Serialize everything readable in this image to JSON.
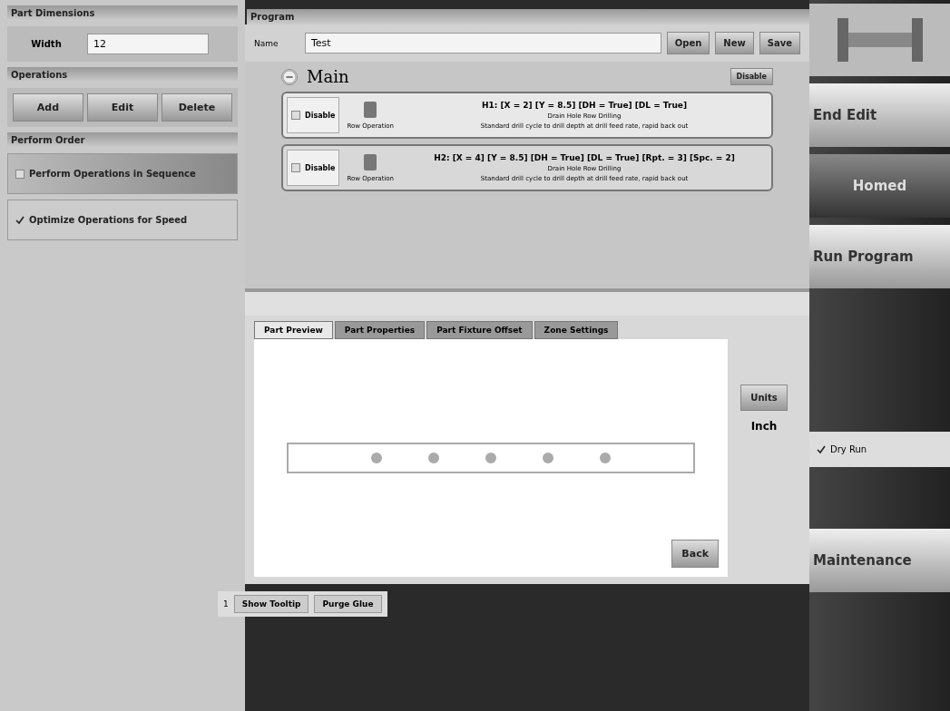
{
  "part_dimensions": {
    "title": "Part Dimensions",
    "label": "Width",
    "value": "12"
  },
  "operations": {
    "title": "Operations",
    "buttons": [
      "Add",
      "Edit",
      "Delete"
    ]
  },
  "perform_order": {
    "title": "Perform Order",
    "options": [
      {
        "label": "Perform Operations in Sequence",
        "selected": true,
        "checked": false
      },
      {
        "label": "Optimize Operations for Speed",
        "selected": false,
        "checked": true
      }
    ]
  },
  "program": {
    "title": "Program",
    "name_label": "Name",
    "name_value": "Test",
    "buttons": [
      "Open",
      "New",
      "Save"
    ],
    "group": {
      "title": "Main",
      "expanded": true,
      "disable_label": "Disable",
      "operations": [
        {
          "disable_label": "Disable",
          "checked": false,
          "type_label": "Row Operation",
          "title": "H1: [X = 2] [Y = 8.5] [DH = True] [DL = True]",
          "subtitle": "Drain Hole Row Drilling",
          "description": "Standard drill cycle to drill depth at drill feed rate, rapid back out"
        },
        {
          "disable_label": "Disable",
          "checked": false,
          "type_label": "Row Operation",
          "title": "H2: [X = 4] [Y = 8.5] [DH = True] [DL = True] [Rpt. = 3] [Spc. = 2]",
          "subtitle": "Drain Hole Row Drilling",
          "description": "Standard drill cycle to drill depth at drill feed rate, rapid back out"
        }
      ]
    }
  },
  "tabs": [
    {
      "label": "Part Preview",
      "selected": true
    },
    {
      "label": "Part Properties",
      "selected": false
    },
    {
      "label": "Part Fixture Offset",
      "selected": false
    },
    {
      "label": "Zone Settings",
      "selected": false
    }
  ],
  "preview": {
    "units_button": "Units",
    "units_value": "Inch",
    "back_button": "Back"
  },
  "bottom_bar": {
    "count": "1",
    "buttons": [
      "Show Tooltip",
      "Purge Glue"
    ]
  },
  "side_buttons": [
    {
      "kind": "button",
      "label": "End Edit",
      "dark": false
    },
    {
      "kind": "button",
      "label": "Homed",
      "dark": true
    },
    {
      "kind": "button",
      "label": "Run Program",
      "dark": false
    },
    {
      "kind": "check",
      "label": "Dry Run",
      "checked": true
    },
    {
      "kind": "button",
      "label": "Maintenance",
      "dark": false
    }
  ]
}
